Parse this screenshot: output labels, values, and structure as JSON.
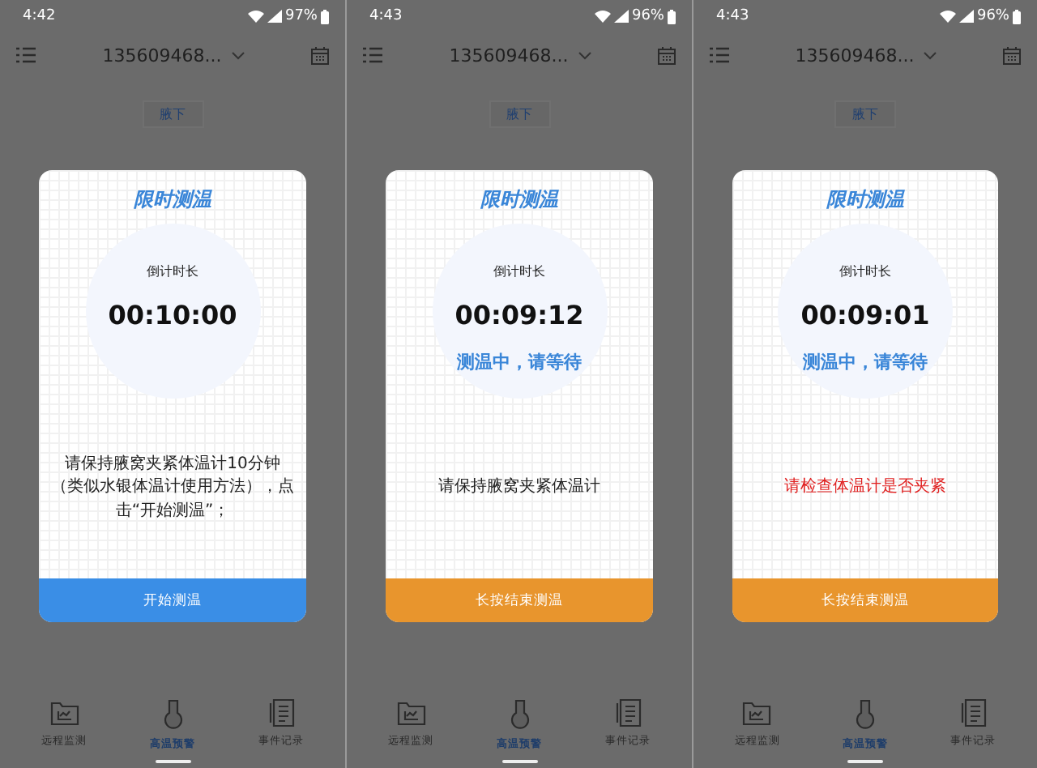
{
  "screens": [
    {
      "status_bar": {
        "time": "4:42",
        "battery": "97%"
      },
      "header": {
        "title": "135609468..."
      },
      "position_tab": "腋下",
      "dialog": {
        "title": "限时测温",
        "countdown_label": "倒计时长",
        "countdown": "00:10:00",
        "message": "请保持腋窝夹紧体温计10分钟（类似水银体温计使用方法），点击“开始测温”；",
        "warning": false,
        "button": {
          "label": "开始测温",
          "kind": "start"
        }
      },
      "nav": [
        {
          "label": "远程监测",
          "selected": false
        },
        {
          "label": "高温预警",
          "selected": true
        },
        {
          "label": "事件记录",
          "selected": false
        }
      ]
    },
    {
      "status_bar": {
        "time": "4:43",
        "battery": "96%"
      },
      "header": {
        "title": "135609468..."
      },
      "position_tab": "腋下",
      "dialog": {
        "title": "限时测温",
        "countdown_label": "倒计时长",
        "countdown": "00:09:12",
        "status": "测温中，请等待",
        "message": "请保持腋窝夹紧体温计",
        "warning": false,
        "button": {
          "label": "长按结束测温",
          "kind": "stop"
        }
      },
      "nav": [
        {
          "label": "远程监测",
          "selected": false
        },
        {
          "label": "高温预警",
          "selected": true
        },
        {
          "label": "事件记录",
          "selected": false
        }
      ]
    },
    {
      "status_bar": {
        "time": "4:43",
        "battery": "96%"
      },
      "header": {
        "title": "135609468..."
      },
      "position_tab": "腋下",
      "dialog": {
        "title": "限时测温",
        "countdown_label": "倒计时长",
        "countdown": "00:09:01",
        "status": "测温中，请等待",
        "message": "请检查体温计是否夹紧",
        "warning": true,
        "button": {
          "label": "长按结束测温",
          "kind": "stop"
        }
      },
      "nav": [
        {
          "label": "远程监测",
          "selected": false
        },
        {
          "label": "高温预警",
          "selected": true
        },
        {
          "label": "事件记录",
          "selected": false
        }
      ]
    }
  ]
}
